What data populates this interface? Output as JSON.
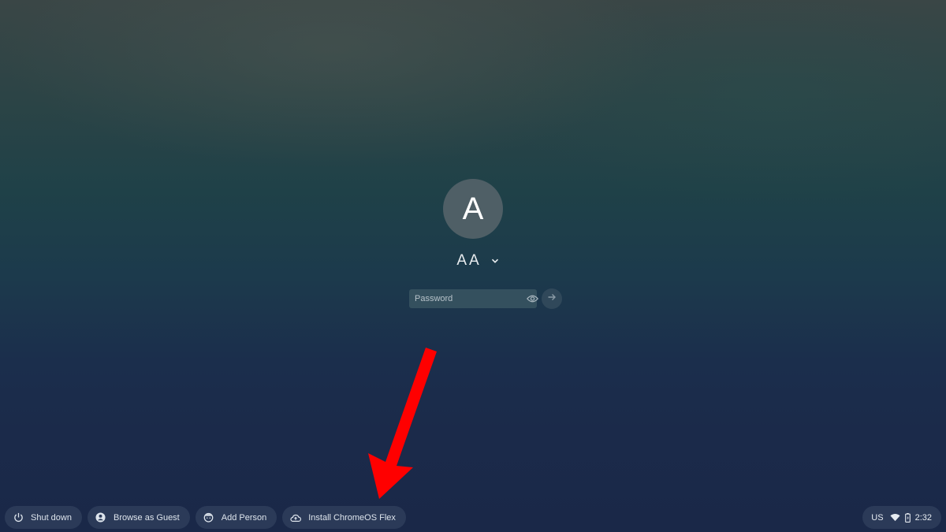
{
  "user": {
    "avatar_initial": "A",
    "display_name": "AA"
  },
  "password": {
    "placeholder": "Password",
    "value": ""
  },
  "shelf": {
    "buttons": [
      {
        "label": "Shut down",
        "icon": "power-icon"
      },
      {
        "label": "Browse as Guest",
        "icon": "guest-icon"
      },
      {
        "label": "Add Person",
        "icon": "add-person-icon"
      },
      {
        "label": "Install ChromeOS Flex",
        "icon": "cloud-upload-icon"
      }
    ]
  },
  "tray": {
    "keyboard_layout": "US",
    "time": "2:32"
  },
  "annotation": {
    "arrow_color": "#ff0000"
  }
}
